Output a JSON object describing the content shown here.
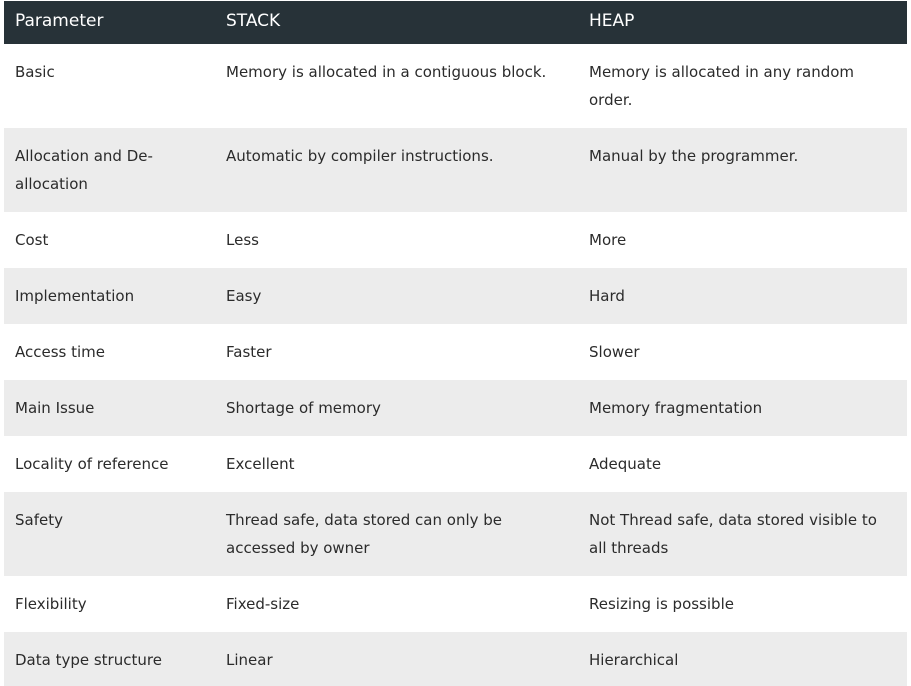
{
  "table": {
    "headers": [
      "Parameter",
      "STACK",
      "HEAP"
    ],
    "rows": [
      [
        "Basic",
        "Memory is allocated in a contiguous block.",
        "Memory is allocated in any random order."
      ],
      [
        "Allocation and De-allocation",
        "Automatic by compiler instructions.",
        "Manual by the programmer."
      ],
      [
        "Cost",
        "Less",
        "More"
      ],
      [
        "Implementation",
        "Easy",
        "Hard"
      ],
      [
        "Access time",
        "Faster",
        "Slower"
      ],
      [
        "Main Issue",
        "Shortage of memory",
        "Memory fragmentation"
      ],
      [
        "Locality of reference",
        "Excellent",
        "Adequate"
      ],
      [
        "Safety",
        "Thread safe, data stored can only be accessed by owner",
        "Not Thread safe, data stored visible to all threads"
      ],
      [
        "Flexibility",
        "Fixed-size",
        "Resizing is possible"
      ],
      [
        "Data type structure",
        "Linear",
        "Hierarchical"
      ]
    ]
  },
  "colors": {
    "header_bg": "#273238",
    "header_text": "#ffffff",
    "row_alt_bg": "#ececec",
    "body_text": "#2b2b2b"
  }
}
